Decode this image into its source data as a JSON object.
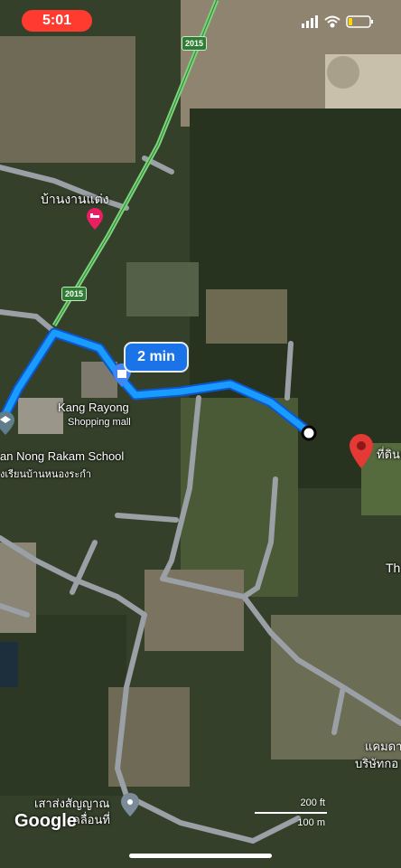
{
  "status_bar": {
    "time": "5:01",
    "icons": [
      "signal-icon",
      "wifi-icon",
      "battery-icon"
    ]
  },
  "route": {
    "duration": "2 min",
    "color": "#1a9cff"
  },
  "highway_shields": [
    "2015",
    "2015"
  ],
  "places": {
    "wedding_shop": "บ้านงานแต่ง",
    "mall_name": "Kang Rayong",
    "mall_type": "Shopping mall",
    "school_en": "an Nong Rakam School",
    "school_th": "งเรียนบ้านหนองระกำ",
    "destination": "ที่ดินแ",
    "right_label_1": "Th",
    "right_label_2": "แคมดา",
    "right_label_3": "บริษัทกอ",
    "tower_label_1": "เสาส่งสัญญาณ",
    "tower_label_2": "คลื่อนที่"
  },
  "scale": {
    "feet": "200 ft",
    "meters": "100 m"
  },
  "logo": "Google",
  "colors": {
    "route": "#1a9cff",
    "destination_pin": "#e53935",
    "status_time_bg": "#ff3b30",
    "highway": "#7bd37b"
  }
}
